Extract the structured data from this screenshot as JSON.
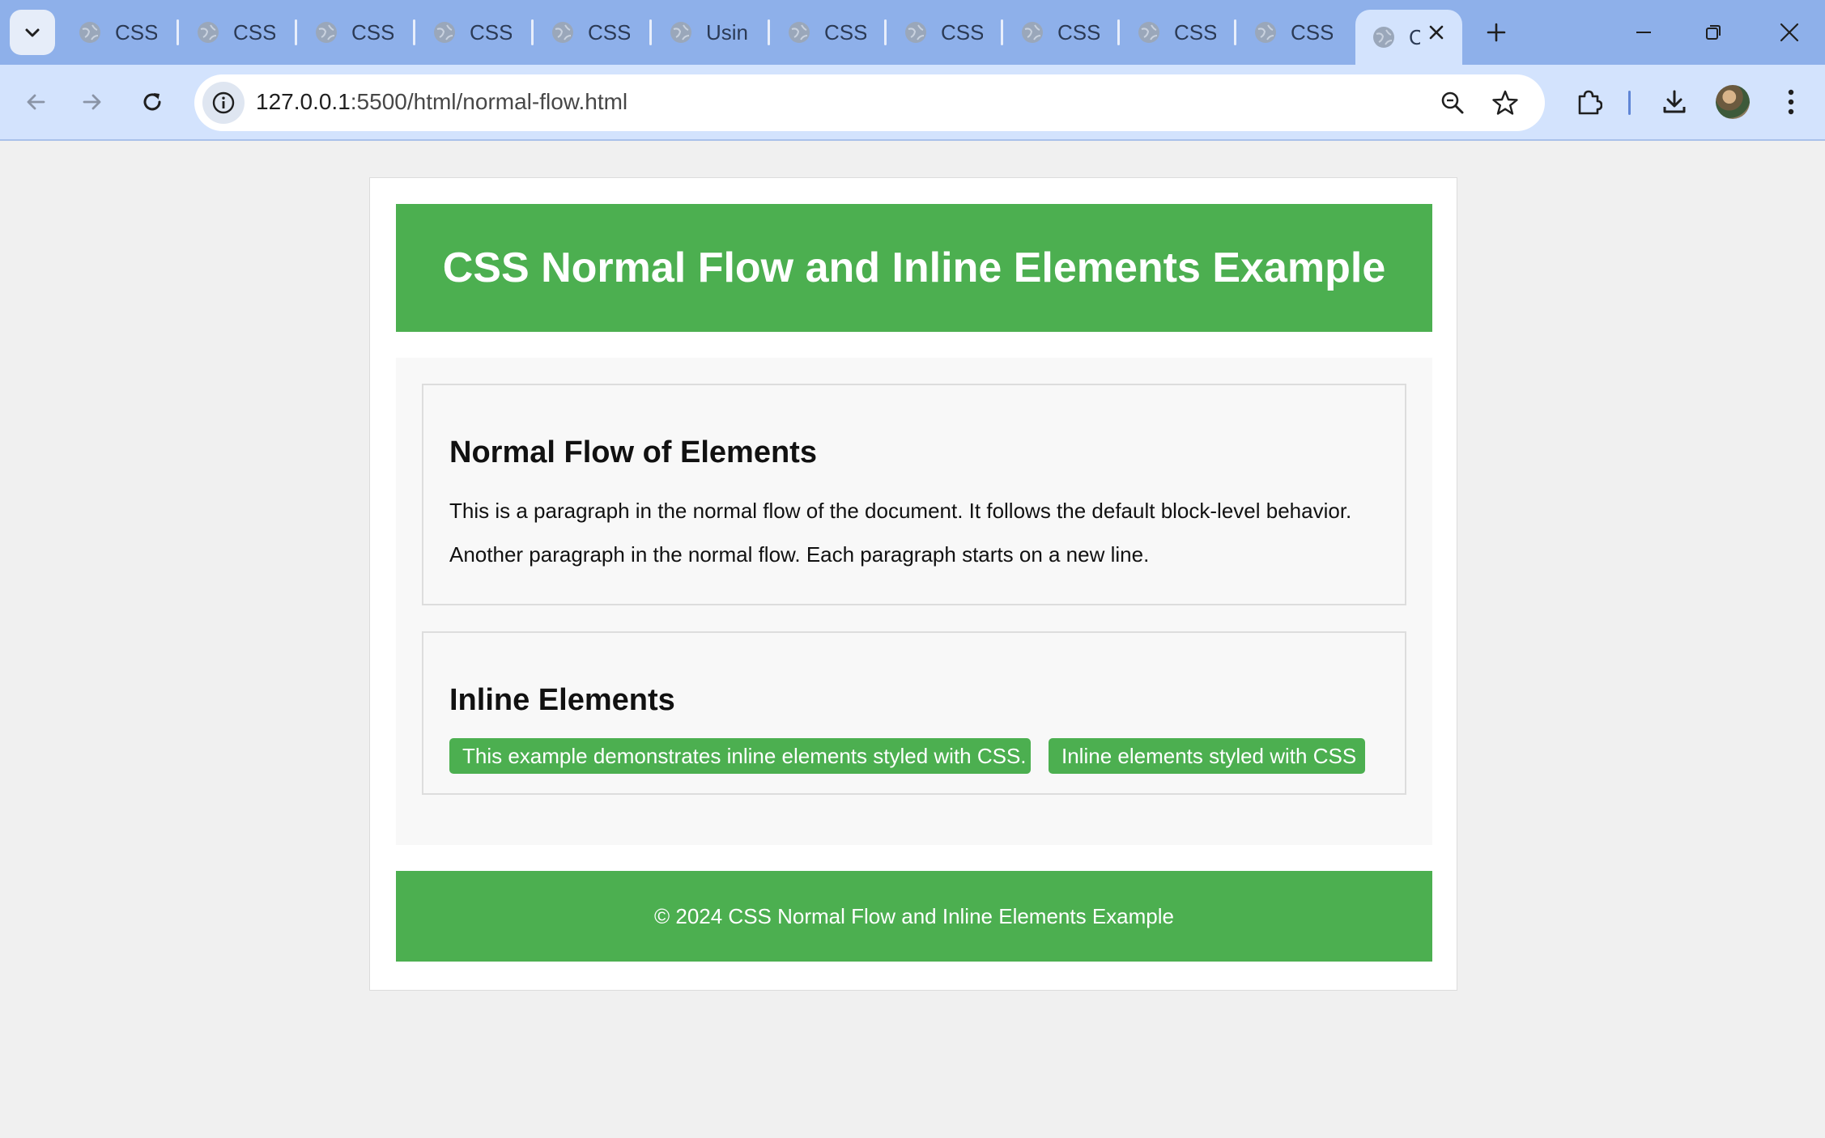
{
  "browser": {
    "tabs": [
      {
        "label": "CSS S"
      },
      {
        "label": "CSS I"
      },
      {
        "label": "CSS S"
      },
      {
        "label": "CSS S"
      },
      {
        "label": "CSS C"
      },
      {
        "label": "Using"
      },
      {
        "label": "CSS I"
      },
      {
        "label": "CSS I"
      },
      {
        "label": "CSS I"
      },
      {
        "label": "CSS C"
      },
      {
        "label": "CSS T"
      },
      {
        "label": "C"
      }
    ],
    "url_host": "127.0.0.1",
    "url_path": ":5500/html/normal-flow.html"
  },
  "page": {
    "header_title": "CSS Normal Flow and Inline Elements Example",
    "sections": [
      {
        "heading": "Normal Flow of Elements",
        "paragraphs": [
          "This is a paragraph in the normal flow of the document. It follows the default block-level behavior.",
          "Another paragraph in the normal flow. Each paragraph starts on a new line."
        ]
      },
      {
        "heading": "Inline Elements",
        "inline_items": [
          "This example demonstrates inline elements styled with CSS.",
          "Inline elements styled with CSS"
        ]
      }
    ],
    "footer_text": "© 2024 CSS Normal Flow and Inline Elements Example"
  },
  "colors": {
    "accent_green": "#4caf50",
    "tabstrip": "#8eb0ea",
    "toolbar": "#d3e3fd"
  }
}
